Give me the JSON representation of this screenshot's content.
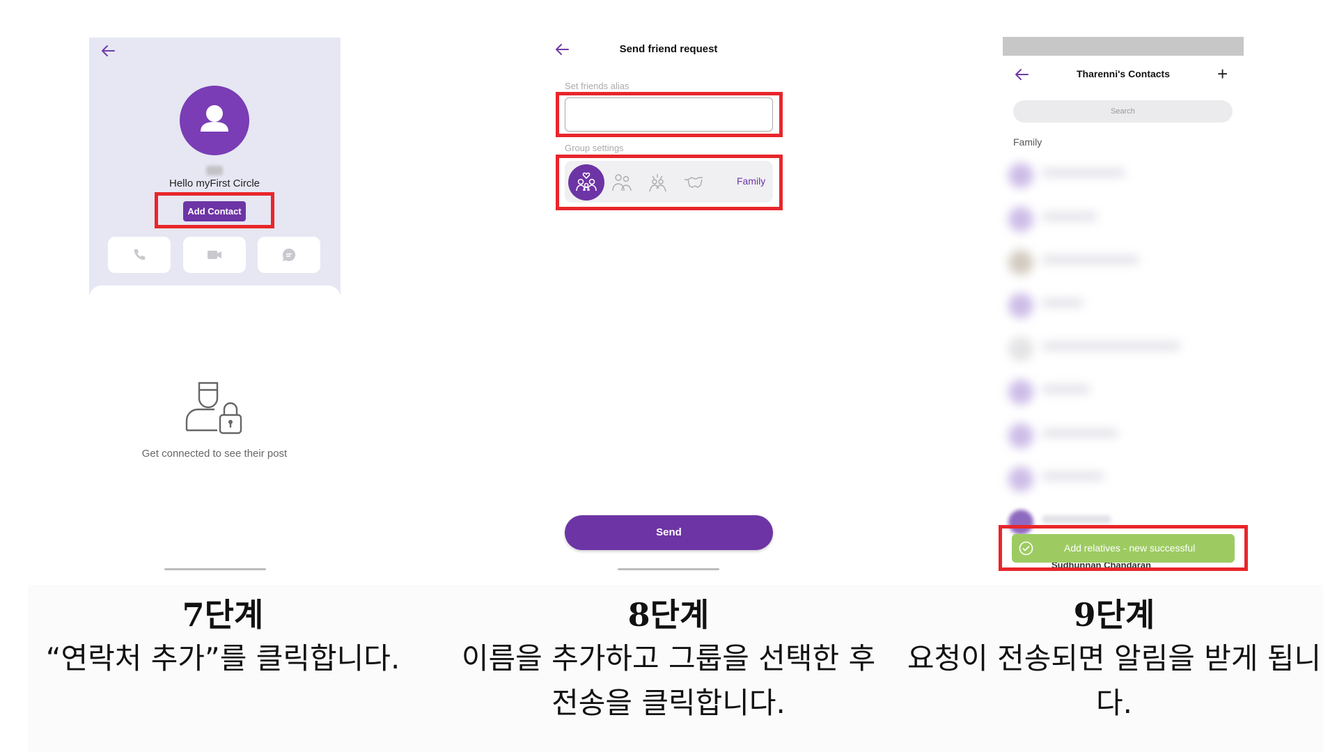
{
  "panel1": {
    "hello_text": "Hello myFirst Circle",
    "add_contact_label": "Add Contact",
    "connect_message": "Get connected to see their post"
  },
  "panel2": {
    "title": "Send friend request",
    "alias_label": "Set friends alias",
    "alias_value": "",
    "group_label": "Group settings",
    "selected_group": "Family",
    "send_label": "Send"
  },
  "panel3": {
    "title": "Tharenni's  Contacts",
    "search_placeholder": "Search",
    "section_label": "Family",
    "toast_text": "Add relatives - new successful",
    "partial_contact": "Sudhunnan Chandaran"
  },
  "captions": [
    {
      "step": "7단계",
      "lines": [
        "“연락처 추가”를 클릭합니다."
      ]
    },
    {
      "step": "8단계",
      "lines": [
        "이름을 추가하고 그룹을 선택한 후",
        "전송을 클릭합니다."
      ]
    },
    {
      "step": "9단계",
      "lines": [
        "요청이 전송되면 알림을 받게 됩니",
        "다."
      ]
    }
  ],
  "colors": {
    "accent_purple": "#6d34a5",
    "highlight_red": "#e8262b",
    "toast_green": "#9dcb62"
  },
  "icons": [
    "back-arrow-icon",
    "user-icon",
    "phone-icon",
    "video-icon",
    "chat-icon",
    "user-lock-icon",
    "family-icon",
    "parents-icon",
    "friends-icon",
    "handshake-icon",
    "plus-icon",
    "check-circle-icon"
  ]
}
